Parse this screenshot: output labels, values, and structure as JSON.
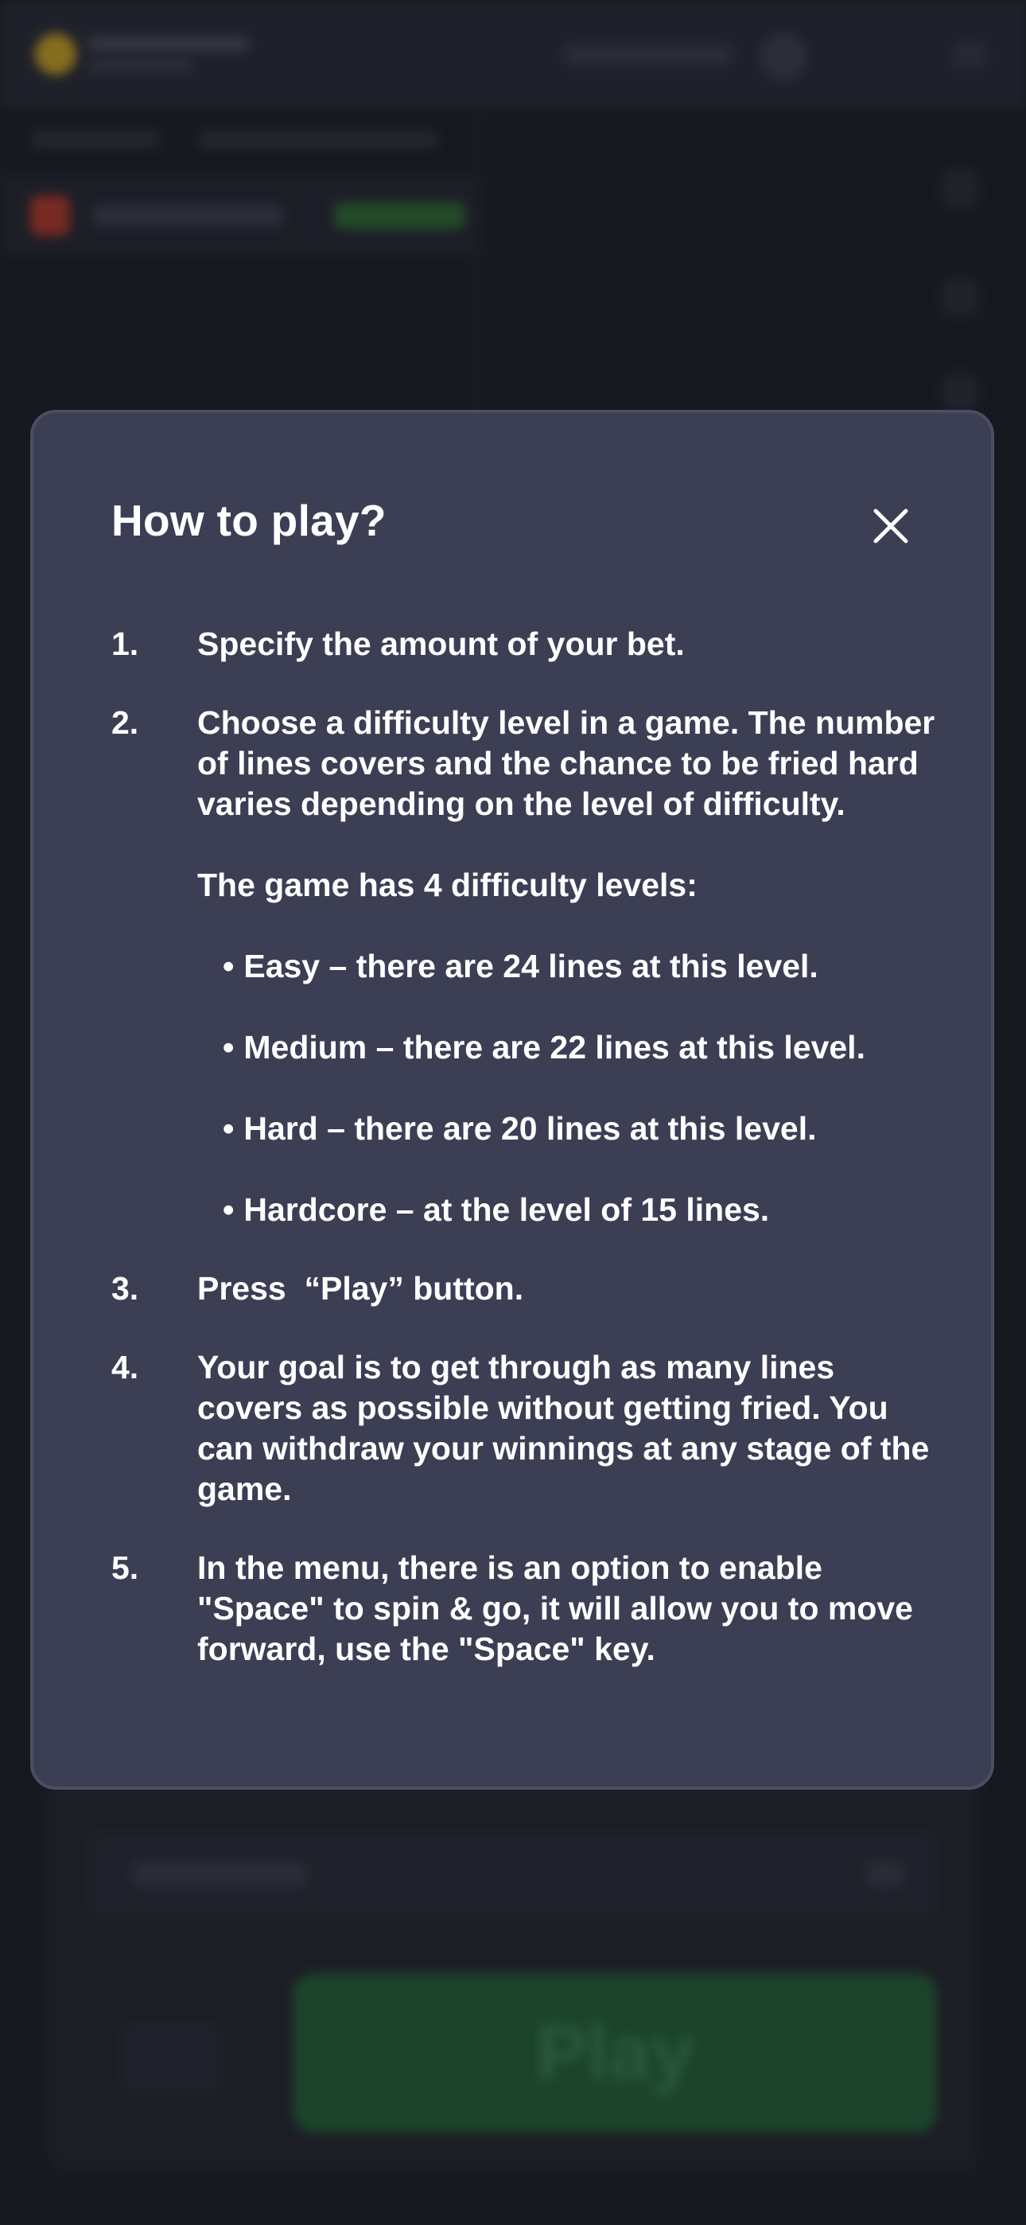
{
  "modal": {
    "title": "How to play?",
    "close_icon": "close-icon",
    "steps": [
      {
        "number": "1.",
        "text": "Specify the amount of your bet."
      },
      {
        "number": "2.",
        "text": "Choose a difficulty level in a game. The number of lines covers and the chance to be fried hard varies depending on the level of difficulty.",
        "levels_intro": "The game has 4 difficulty levels:",
        "levels": [
          "Easy – there are 24 lines at this level.",
          "Medium – there are 22 lines at this level.",
          "Hard – there are 20 lines at this level.",
          "Hardcore – at the level of 15 lines."
        ]
      },
      {
        "number": "3.",
        "text": "Press  “Play” button."
      },
      {
        "number": "4.",
        "text": "Your goal is to get through as many lines covers as possible without getting fried. You can withdraw your winnings at any stage of the game."
      },
      {
        "number": "5.",
        "text": "In the menu, there is an option to enable \"Space\" to spin & go, it will allow you to move forward, use the \"Space\" key."
      }
    ]
  },
  "background": {
    "play_button_label": "Play"
  },
  "colors": {
    "modal_bg": "#3c3e54",
    "page_bg": "#1e1f29",
    "text": "#ffffff"
  }
}
